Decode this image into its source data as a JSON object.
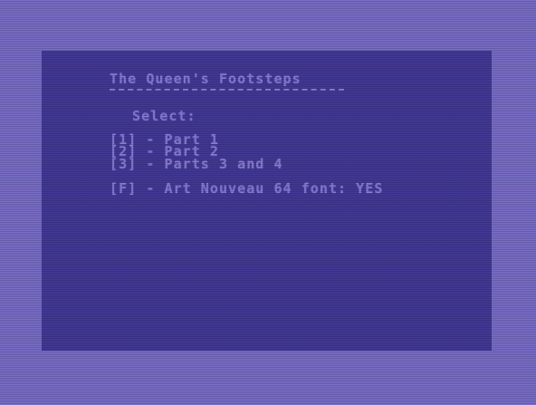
{
  "colors": {
    "border": "#7b70c8",
    "screen": "#433a96",
    "text": "#8a80d6"
  },
  "menu": {
    "title": "The Queen's Footsteps",
    "select_label": "Select:",
    "options": [
      {
        "key": "[1]",
        "label": "[1] - Part 1"
      },
      {
        "key": "[2]",
        "label": "[2] - Part 2"
      },
      {
        "key": "[3]",
        "label": "[3] - Parts 3 and 4"
      }
    ],
    "font_option": "[F] - Art Nouveau 64 font: YES"
  }
}
